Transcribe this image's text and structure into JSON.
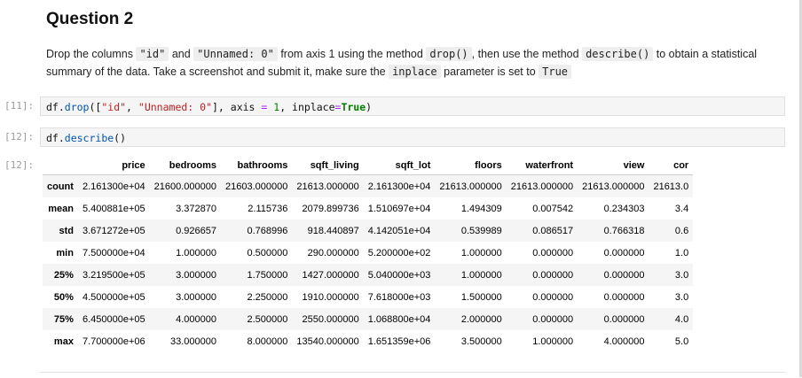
{
  "heading": "Question 2",
  "instruction": {
    "p1": "Drop the columns ",
    "c1": "\"id\"",
    "p2": " and ",
    "c2": "\"Unnamed: 0\"",
    "p3": " from axis 1 using the method ",
    "c3": "drop()",
    "p4": ", then use the method ",
    "c4": "describe()",
    "p5": " to obtain a statistical summary of the data. Take a screenshot and submit it, make sure the ",
    "c5": "inplace",
    "p6": " parameter is set to ",
    "c6": "True"
  },
  "cells": {
    "drop": {
      "prompt": "[11]:",
      "t1": "df.",
      "t2": "drop",
      "t3": "([",
      "t4": "\"id\"",
      "t5": ", ",
      "t6": "\"Unnamed: 0\"",
      "t7": "], axis ",
      "t8": "=",
      "t9": " ",
      "t10": "1",
      "t11": ", inplace",
      "t12": "=",
      "t13": "True",
      "t14": ")"
    },
    "describe": {
      "prompt": "[12]:",
      "t1": "df.",
      "t2": "describe",
      "t3": "()"
    },
    "output_prompt": "[12]:"
  },
  "table": {
    "columns": [
      "",
      "price",
      "bedrooms",
      "bathrooms",
      "sqft_living",
      "sqft_lot",
      "floors",
      "waterfront",
      "view",
      "cor"
    ],
    "rows": [
      {
        "label": "count",
        "cells": [
          "2.161300e+04",
          "21600.000000",
          "21603.000000",
          "21613.000000",
          "2.161300e+04",
          "21613.000000",
          "21613.000000",
          "21613.000000",
          "21613.0"
        ]
      },
      {
        "label": "mean",
        "cells": [
          "5.400881e+05",
          "3.372870",
          "2.115736",
          "2079.899736",
          "1.510697e+04",
          "1.494309",
          "0.007542",
          "0.234303",
          "3.4"
        ]
      },
      {
        "label": "std",
        "cells": [
          "3.671272e+05",
          "0.926657",
          "0.768996",
          "918.440897",
          "4.142051e+04",
          "0.539989",
          "0.086517",
          "0.766318",
          "0.6"
        ]
      },
      {
        "label": "min",
        "cells": [
          "7.500000e+04",
          "1.000000",
          "0.500000",
          "290.000000",
          "5.200000e+02",
          "1.000000",
          "0.000000",
          "0.000000",
          "1.0"
        ]
      },
      {
        "label": "25%",
        "cells": [
          "3.219500e+05",
          "3.000000",
          "1.750000",
          "1427.000000",
          "5.040000e+03",
          "1.000000",
          "0.000000",
          "0.000000",
          "3.0"
        ]
      },
      {
        "label": "50%",
        "cells": [
          "4.500000e+05",
          "3.000000",
          "2.250000",
          "1910.000000",
          "7.618000e+03",
          "1.500000",
          "0.000000",
          "0.000000",
          "3.0"
        ]
      },
      {
        "label": "75%",
        "cells": [
          "6.450000e+05",
          "4.000000",
          "2.500000",
          "2550.000000",
          "1.068800e+04",
          "2.000000",
          "0.000000",
          "0.000000",
          "4.0"
        ]
      },
      {
        "label": "max",
        "cells": [
          "7.700000e+06",
          "33.000000",
          "8.000000",
          "13540.000000",
          "1.651359e+06",
          "3.500000",
          "1.000000",
          "4.000000",
          "5.0"
        ]
      }
    ]
  }
}
